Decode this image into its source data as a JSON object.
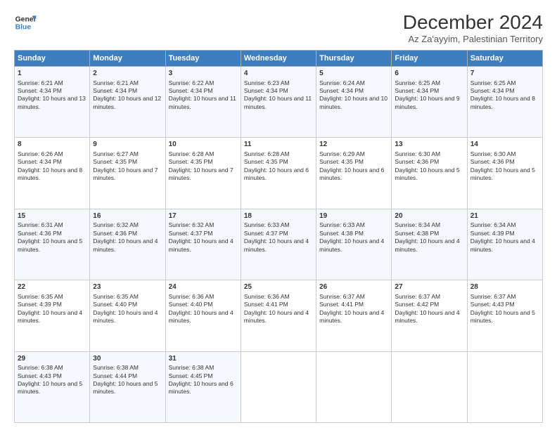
{
  "logo": {
    "line1": "General",
    "line2": "Blue"
  },
  "title": "December 2024",
  "subtitle": "Az Za'ayyim, Palestinian Territory",
  "headers": [
    "Sunday",
    "Monday",
    "Tuesday",
    "Wednesday",
    "Thursday",
    "Friday",
    "Saturday"
  ],
  "weeks": [
    [
      {
        "day": "1",
        "sunrise": "6:21 AM",
        "sunset": "4:34 PM",
        "daylight": "10 hours and 13 minutes."
      },
      {
        "day": "2",
        "sunrise": "6:21 AM",
        "sunset": "4:34 PM",
        "daylight": "10 hours and 12 minutes."
      },
      {
        "day": "3",
        "sunrise": "6:22 AM",
        "sunset": "4:34 PM",
        "daylight": "10 hours and 11 minutes."
      },
      {
        "day": "4",
        "sunrise": "6:23 AM",
        "sunset": "4:34 PM",
        "daylight": "10 hours and 11 minutes."
      },
      {
        "day": "5",
        "sunrise": "6:24 AM",
        "sunset": "4:34 PM",
        "daylight": "10 hours and 10 minutes."
      },
      {
        "day": "6",
        "sunrise": "6:25 AM",
        "sunset": "4:34 PM",
        "daylight": "10 hours and 9 minutes."
      },
      {
        "day": "7",
        "sunrise": "6:25 AM",
        "sunset": "4:34 PM",
        "daylight": "10 hours and 8 minutes."
      }
    ],
    [
      {
        "day": "8",
        "sunrise": "6:26 AM",
        "sunset": "4:34 PM",
        "daylight": "10 hours and 8 minutes."
      },
      {
        "day": "9",
        "sunrise": "6:27 AM",
        "sunset": "4:35 PM",
        "daylight": "10 hours and 7 minutes."
      },
      {
        "day": "10",
        "sunrise": "6:28 AM",
        "sunset": "4:35 PM",
        "daylight": "10 hours and 7 minutes."
      },
      {
        "day": "11",
        "sunrise": "6:28 AM",
        "sunset": "4:35 PM",
        "daylight": "10 hours and 6 minutes."
      },
      {
        "day": "12",
        "sunrise": "6:29 AM",
        "sunset": "4:35 PM",
        "daylight": "10 hours and 6 minutes."
      },
      {
        "day": "13",
        "sunrise": "6:30 AM",
        "sunset": "4:36 PM",
        "daylight": "10 hours and 5 minutes."
      },
      {
        "day": "14",
        "sunrise": "6:30 AM",
        "sunset": "4:36 PM",
        "daylight": "10 hours and 5 minutes."
      }
    ],
    [
      {
        "day": "15",
        "sunrise": "6:31 AM",
        "sunset": "4:36 PM",
        "daylight": "10 hours and 5 minutes."
      },
      {
        "day": "16",
        "sunrise": "6:32 AM",
        "sunset": "4:36 PM",
        "daylight": "10 hours and 4 minutes."
      },
      {
        "day": "17",
        "sunrise": "6:32 AM",
        "sunset": "4:37 PM",
        "daylight": "10 hours and 4 minutes."
      },
      {
        "day": "18",
        "sunrise": "6:33 AM",
        "sunset": "4:37 PM",
        "daylight": "10 hours and 4 minutes."
      },
      {
        "day": "19",
        "sunrise": "6:33 AM",
        "sunset": "4:38 PM",
        "daylight": "10 hours and 4 minutes."
      },
      {
        "day": "20",
        "sunrise": "6:34 AM",
        "sunset": "4:38 PM",
        "daylight": "10 hours and 4 minutes."
      },
      {
        "day": "21",
        "sunrise": "6:34 AM",
        "sunset": "4:39 PM",
        "daylight": "10 hours and 4 minutes."
      }
    ],
    [
      {
        "day": "22",
        "sunrise": "6:35 AM",
        "sunset": "4:39 PM",
        "daylight": "10 hours and 4 minutes."
      },
      {
        "day": "23",
        "sunrise": "6:35 AM",
        "sunset": "4:40 PM",
        "daylight": "10 hours and 4 minutes."
      },
      {
        "day": "24",
        "sunrise": "6:36 AM",
        "sunset": "4:40 PM",
        "daylight": "10 hours and 4 minutes."
      },
      {
        "day": "25",
        "sunrise": "6:36 AM",
        "sunset": "4:41 PM",
        "daylight": "10 hours and 4 minutes."
      },
      {
        "day": "26",
        "sunrise": "6:37 AM",
        "sunset": "4:41 PM",
        "daylight": "10 hours and 4 minutes."
      },
      {
        "day": "27",
        "sunrise": "6:37 AM",
        "sunset": "4:42 PM",
        "daylight": "10 hours and 4 minutes."
      },
      {
        "day": "28",
        "sunrise": "6:37 AM",
        "sunset": "4:43 PM",
        "daylight": "10 hours and 5 minutes."
      }
    ],
    [
      {
        "day": "29",
        "sunrise": "6:38 AM",
        "sunset": "4:43 PM",
        "daylight": "10 hours and 5 minutes."
      },
      {
        "day": "30",
        "sunrise": "6:38 AM",
        "sunset": "4:44 PM",
        "daylight": "10 hours and 5 minutes."
      },
      {
        "day": "31",
        "sunrise": "6:38 AM",
        "sunset": "4:45 PM",
        "daylight": "10 hours and 6 minutes."
      },
      null,
      null,
      null,
      null
    ]
  ],
  "labels": {
    "sunrise": "Sunrise:",
    "sunset": "Sunset:",
    "daylight": "Daylight:"
  }
}
